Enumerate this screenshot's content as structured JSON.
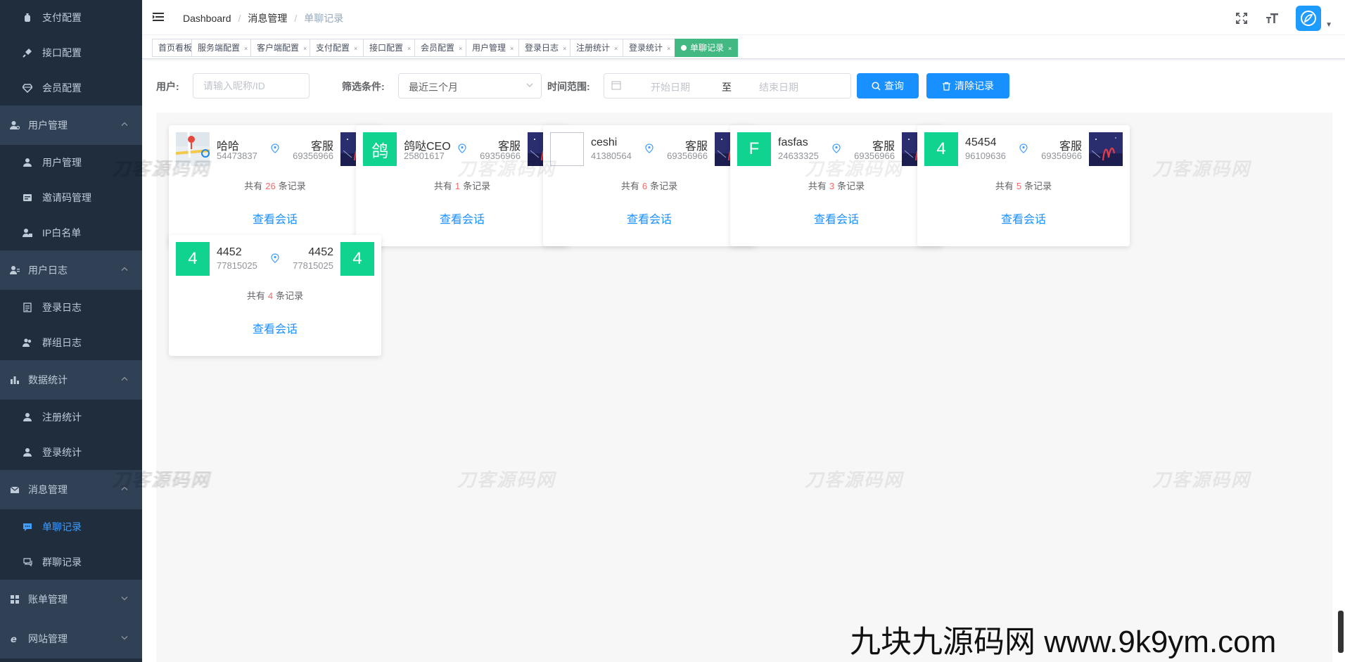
{
  "sidebar": {
    "items": [
      {
        "kind": "sub",
        "label": "支付配置",
        "icon": "money-bag-icon"
      },
      {
        "kind": "sub",
        "label": "接口配置",
        "icon": "plug-icon"
      },
      {
        "kind": "sub",
        "label": "会员配置",
        "icon": "diamond-icon"
      },
      {
        "kind": "top",
        "label": "用户管理",
        "icon": "user-cog-icon",
        "expanded": true
      },
      {
        "kind": "sub",
        "label": "用户管理",
        "icon": "user-icon"
      },
      {
        "kind": "sub",
        "label": "邀请码管理",
        "icon": "ticket-icon"
      },
      {
        "kind": "sub",
        "label": "IP白名单",
        "icon": "user-lock-icon"
      },
      {
        "kind": "top",
        "label": "用户日志",
        "icon": "user-log-icon",
        "expanded": true
      },
      {
        "kind": "sub",
        "label": "登录日志",
        "icon": "document-icon"
      },
      {
        "kind": "sub",
        "label": "群组日志",
        "icon": "users-icon"
      },
      {
        "kind": "top",
        "label": "数据统计",
        "icon": "bar-chart-icon",
        "expanded": true
      },
      {
        "kind": "sub",
        "label": "注册统计",
        "icon": "user-icon"
      },
      {
        "kind": "sub",
        "label": "登录统计",
        "icon": "user-icon"
      },
      {
        "kind": "top",
        "label": "消息管理",
        "icon": "envelope-icon",
        "expanded": true
      },
      {
        "kind": "sub",
        "label": "单聊记录",
        "icon": "chat-icon",
        "active": true
      },
      {
        "kind": "sub",
        "label": "群聊记录",
        "icon": "chat-group-icon"
      },
      {
        "kind": "top",
        "label": "账单管理",
        "icon": "grid-icon",
        "expanded": false
      },
      {
        "kind": "top",
        "label": "网站管理",
        "icon": "ie-icon",
        "expanded": false
      }
    ]
  },
  "navbar": {
    "breadcrumb": [
      "Dashboard",
      "消息管理",
      "单聊记录"
    ],
    "separator": "/"
  },
  "tags": [
    {
      "label": "首页看板",
      "closable": false,
      "active": false
    },
    {
      "label": "服务端配置",
      "closable": true,
      "active": false
    },
    {
      "label": "客户端配置",
      "closable": true,
      "active": false
    },
    {
      "label": "支付配置",
      "closable": true,
      "active": false
    },
    {
      "label": "接口配置",
      "closable": true,
      "active": false
    },
    {
      "label": "会员配置",
      "closable": true,
      "active": false
    },
    {
      "label": "用户管理",
      "closable": true,
      "active": false
    },
    {
      "label": "登录日志",
      "closable": true,
      "active": false
    },
    {
      "label": "注册统计",
      "closable": true,
      "active": false
    },
    {
      "label": "登录统计",
      "closable": true,
      "active": false
    },
    {
      "label": "单聊记录",
      "closable": true,
      "active": true
    }
  ],
  "filter": {
    "user_label": "用户:",
    "user_placeholder": "请输入昵称/ID",
    "cond_label": "筛选条件:",
    "cond_value": "最近三个月",
    "range_label": "时间范围:",
    "date_start": "开始日期",
    "date_sep": "至",
    "date_end": "结束日期",
    "search_btn": "查询",
    "clear_btn": "清除记录"
  },
  "cards": [
    {
      "left": {
        "name": "哈哈",
        "id": "54473837",
        "avatar": "image",
        "image": "map-image"
      },
      "right": {
        "name": "客服",
        "id": "69356966",
        "avatar": "image",
        "image": "night-image"
      },
      "count_prefix": "共有",
      "count": "26",
      "count_suffix": "条记录",
      "link": "查看会话"
    },
    {
      "left": {
        "name": "鸽哒CEO",
        "id": "25801617",
        "avatar": "letter",
        "letter": "鸽"
      },
      "right": {
        "name": "客服",
        "id": "69356966",
        "avatar": "image",
        "image": "night-image"
      },
      "count_prefix": "共有",
      "count": "1",
      "count_suffix": "条记录",
      "link": "查看会话"
    },
    {
      "left": {
        "name": "ceshi",
        "id": "41380564",
        "avatar": "broken"
      },
      "right": {
        "name": "客服",
        "id": "69356966",
        "avatar": "image",
        "image": "night-image"
      },
      "count_prefix": "共有",
      "count": "6",
      "count_suffix": "条记录",
      "link": "查看会话"
    },
    {
      "left": {
        "name": "fasfas",
        "id": "24633325",
        "avatar": "letter",
        "letter": "F"
      },
      "right": {
        "name": "客服",
        "id": "69356966",
        "avatar": "image",
        "image": "night-image"
      },
      "count_prefix": "共有",
      "count": "3",
      "count_suffix": "条记录",
      "link": "查看会话"
    },
    {
      "left": {
        "name": "45454",
        "id": "96109636",
        "avatar": "letter",
        "letter": "4"
      },
      "right": {
        "name": "客服",
        "id": "69356966",
        "avatar": "image",
        "image": "night-image"
      },
      "count_prefix": "共有",
      "count": "5",
      "count_suffix": "条记录",
      "link": "查看会话"
    },
    {
      "left": {
        "name": "4452",
        "id": "77815025",
        "avatar": "letter",
        "letter": "4"
      },
      "right": {
        "name": "4452",
        "id": "77815025",
        "avatar": "letter",
        "letter": "4"
      },
      "count_prefix": "共有",
      "count": "4",
      "count_suffix": "条记录",
      "link": "查看会话"
    }
  ],
  "watermark": "刀客源码网",
  "promo": "九块九源码网 www.9k9ym.com",
  "colors": {
    "sidebar_bg": "#1f2d3d",
    "group_bg": "#304156",
    "active": "#409eff",
    "primary": "#1890ff",
    "tag_active": "#42b983",
    "avatar_letter": "#10d38f",
    "count": "#f56c6c"
  }
}
